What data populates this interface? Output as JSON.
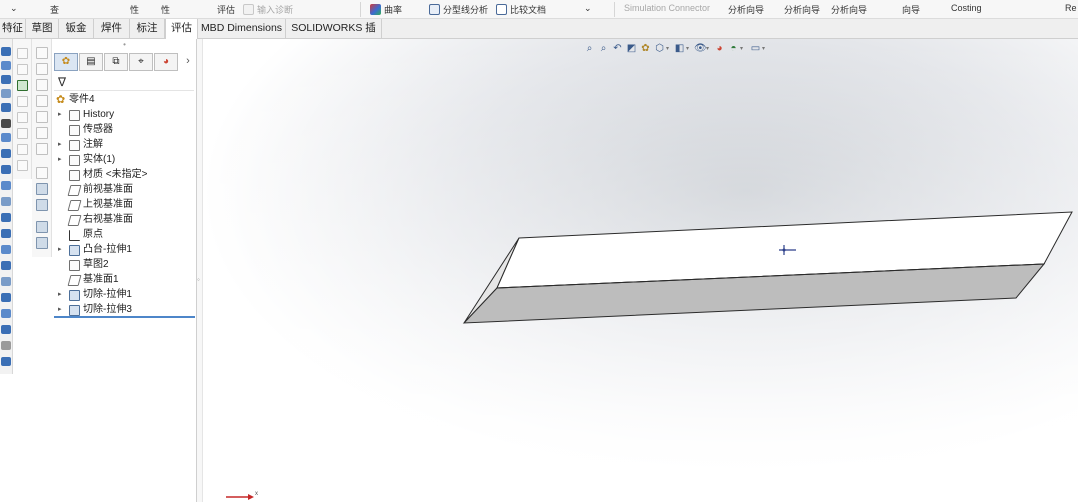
{
  "ribbon": {
    "items": [
      "查",
      "性",
      "性",
      "评估",
      "输入诊断",
      "曲率",
      "分型线分析",
      "比较文档",
      "Simulation Connector",
      "分析向导",
      "分析向导",
      "分析向导",
      "向导",
      "Costing",
      "Re"
    ]
  },
  "tabs": [
    "特征",
    "草图",
    "钣金",
    "焊件",
    "标注",
    "评估",
    "MBD Dimensions",
    "SOLIDWORKS 插件"
  ],
  "feature_tree": {
    "root": "零件4",
    "nodes": [
      {
        "label": "History",
        "expandable": true
      },
      {
        "label": "传感器",
        "expandable": false
      },
      {
        "label": "注解",
        "expandable": true
      },
      {
        "label": "实体(1)",
        "expandable": true
      },
      {
        "label": "材质 <未指定>",
        "expandable": false
      },
      {
        "label": "前视基准面",
        "expandable": false
      },
      {
        "label": "上视基准面",
        "expandable": false
      },
      {
        "label": "右视基准面",
        "expandable": false
      },
      {
        "label": "原点",
        "expandable": false
      },
      {
        "label": "凸台-拉伸1",
        "expandable": true
      },
      {
        "label": "草图2",
        "expandable": false
      },
      {
        "label": "基准面1",
        "expandable": false
      },
      {
        "label": "切除-拉伸1",
        "expandable": true
      },
      {
        "label": "切除-拉伸3",
        "expandable": true
      }
    ]
  },
  "icons": {
    "filter": "filter-icon",
    "part": "part-icon",
    "more": "chevron-right-icon"
  },
  "colors": {
    "accent": "#4d86c9",
    "model_top": "#ffffff",
    "model_front": "#bdbdbd",
    "model_edge": "#2b2b2b"
  }
}
